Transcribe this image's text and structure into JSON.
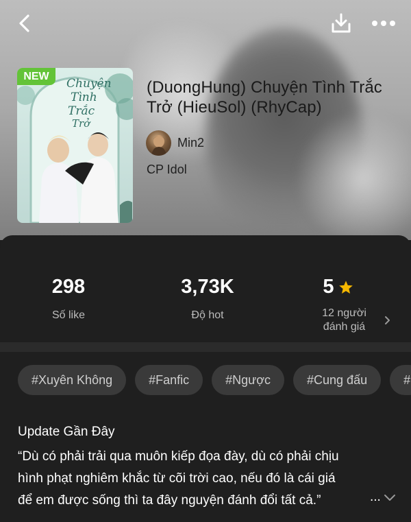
{
  "header": {
    "back_icon": "chevron-left-icon",
    "download_icon": "download-icon",
    "more_icon": "more-horizontal-icon"
  },
  "book": {
    "badge": "NEW",
    "title": "(DuongHung) Chuyện Tình Trắc Trở (HieuSol) (RhyCap)",
    "author": "Min2",
    "category": "CP Idol"
  },
  "stats": {
    "likes": {
      "value": "298",
      "label": "Số like"
    },
    "hot": {
      "value": "3,73K",
      "label": "Độ hot"
    },
    "rating": {
      "value": "5",
      "label_line1": "12 người",
      "label_line2": "đánh giá",
      "star_color": "#f5b700"
    }
  },
  "tags": [
    "#Xuyên Không",
    "#Fanfic",
    "#Ngược",
    "#Cung đấu",
    "#"
  ],
  "update": {
    "title": "Update Gần Đây",
    "line1": "“Dù có phải trải qua muôn kiếp đọa đày, dù có phải chịu",
    "line2": "hình phạt nghiêm khắc từ cõi trời cao, nếu đó là cái giá",
    "line3": "để em được sống thì ta đây nguyện đánh đổi tất cả.”",
    "ellipsis": "..."
  },
  "colors": {
    "badge_green": "#63c338",
    "panel_bg": "#1f1f1f",
    "tag_bg": "#3a3a3a"
  }
}
